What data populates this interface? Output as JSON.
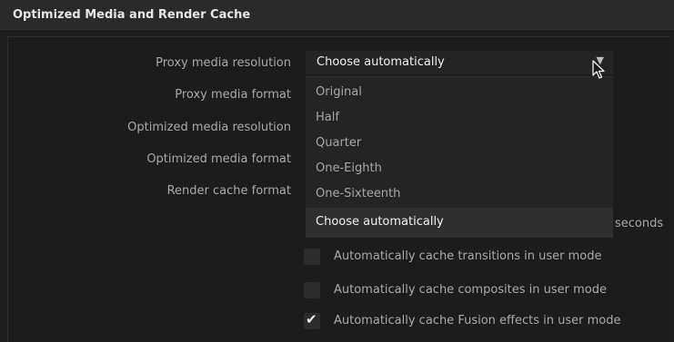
{
  "panel": {
    "title": "Optimized Media and Render Cache"
  },
  "fields": {
    "proxy_media_resolution": "Proxy media resolution",
    "proxy_media_format": "Proxy media format",
    "optimized_media_resolution": "Optimized media resolution",
    "optimized_media_format": "Optimized media format",
    "render_cache_format": "Render cache format"
  },
  "proxy_resolution_select": {
    "value": "Choose automatically",
    "options": [
      "Original",
      "Half",
      "Quarter",
      "One-Eighth",
      "One-Sixteenth",
      "Choose automatically"
    ],
    "selected_index": 5
  },
  "partially_hidden_suffix": "seconds",
  "checkboxes": [
    {
      "label": "Automatically cache transitions in user mode",
      "checked": false
    },
    {
      "label": "Automatically cache composites in user mode",
      "checked": false
    },
    {
      "label": "Automatically cache Fusion effects in user mode",
      "checked": true
    }
  ],
  "icons": {
    "dropdown": "chevron-down-icon",
    "cursor": "mouse-pointer-icon",
    "check": "checkmark-icon"
  },
  "colors": {
    "background": "#1c1c1c",
    "header": "#2a2a2b",
    "dropdown_bg": "#242425",
    "selected_row": "#2f2f30",
    "text_primary": "#f0f0f0",
    "text_secondary": "#a9a9a9"
  }
}
